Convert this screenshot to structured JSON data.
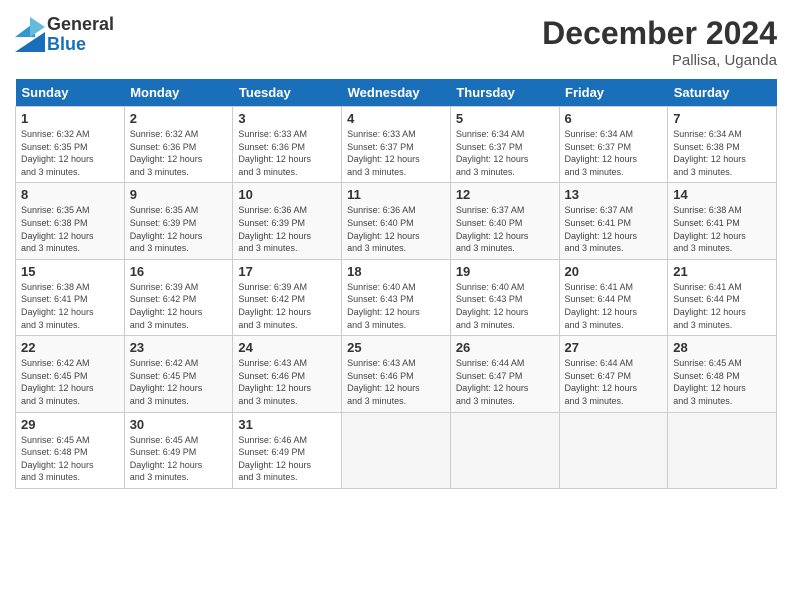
{
  "logo": {
    "general": "General",
    "blue": "Blue"
  },
  "title": "December 2024",
  "location": "Pallisa, Uganda",
  "days_header": [
    "Sunday",
    "Monday",
    "Tuesday",
    "Wednesday",
    "Thursday",
    "Friday",
    "Saturday"
  ],
  "weeks": [
    [
      {
        "num": "1",
        "rise": "6:32 AM",
        "set": "6:35 PM",
        "daylight": "12 hours and 3 minutes."
      },
      {
        "num": "2",
        "rise": "6:32 AM",
        "set": "6:36 PM",
        "daylight": "12 hours and 3 minutes."
      },
      {
        "num": "3",
        "rise": "6:33 AM",
        "set": "6:36 PM",
        "daylight": "12 hours and 3 minutes."
      },
      {
        "num": "4",
        "rise": "6:33 AM",
        "set": "6:37 PM",
        "daylight": "12 hours and 3 minutes."
      },
      {
        "num": "5",
        "rise": "6:34 AM",
        "set": "6:37 PM",
        "daylight": "12 hours and 3 minutes."
      },
      {
        "num": "6",
        "rise": "6:34 AM",
        "set": "6:37 PM",
        "daylight": "12 hours and 3 minutes."
      },
      {
        "num": "7",
        "rise": "6:34 AM",
        "set": "6:38 PM",
        "daylight": "12 hours and 3 minutes."
      }
    ],
    [
      {
        "num": "8",
        "rise": "6:35 AM",
        "set": "6:38 PM",
        "daylight": "12 hours and 3 minutes."
      },
      {
        "num": "9",
        "rise": "6:35 AM",
        "set": "6:39 PM",
        "daylight": "12 hours and 3 minutes."
      },
      {
        "num": "10",
        "rise": "6:36 AM",
        "set": "6:39 PM",
        "daylight": "12 hours and 3 minutes."
      },
      {
        "num": "11",
        "rise": "6:36 AM",
        "set": "6:40 PM",
        "daylight": "12 hours and 3 minutes."
      },
      {
        "num": "12",
        "rise": "6:37 AM",
        "set": "6:40 PM",
        "daylight": "12 hours and 3 minutes."
      },
      {
        "num": "13",
        "rise": "6:37 AM",
        "set": "6:41 PM",
        "daylight": "12 hours and 3 minutes."
      },
      {
        "num": "14",
        "rise": "6:38 AM",
        "set": "6:41 PM",
        "daylight": "12 hours and 3 minutes."
      }
    ],
    [
      {
        "num": "15",
        "rise": "6:38 AM",
        "set": "6:41 PM",
        "daylight": "12 hours and 3 minutes."
      },
      {
        "num": "16",
        "rise": "6:39 AM",
        "set": "6:42 PM",
        "daylight": "12 hours and 3 minutes."
      },
      {
        "num": "17",
        "rise": "6:39 AM",
        "set": "6:42 PM",
        "daylight": "12 hours and 3 minutes."
      },
      {
        "num": "18",
        "rise": "6:40 AM",
        "set": "6:43 PM",
        "daylight": "12 hours and 3 minutes."
      },
      {
        "num": "19",
        "rise": "6:40 AM",
        "set": "6:43 PM",
        "daylight": "12 hours and 3 minutes."
      },
      {
        "num": "20",
        "rise": "6:41 AM",
        "set": "6:44 PM",
        "daylight": "12 hours and 3 minutes."
      },
      {
        "num": "21",
        "rise": "6:41 AM",
        "set": "6:44 PM",
        "daylight": "12 hours and 3 minutes."
      }
    ],
    [
      {
        "num": "22",
        "rise": "6:42 AM",
        "set": "6:45 PM",
        "daylight": "12 hours and 3 minutes."
      },
      {
        "num": "23",
        "rise": "6:42 AM",
        "set": "6:45 PM",
        "daylight": "12 hours and 3 minutes."
      },
      {
        "num": "24",
        "rise": "6:43 AM",
        "set": "6:46 PM",
        "daylight": "12 hours and 3 minutes."
      },
      {
        "num": "25",
        "rise": "6:43 AM",
        "set": "6:46 PM",
        "daylight": "12 hours and 3 minutes."
      },
      {
        "num": "26",
        "rise": "6:44 AM",
        "set": "6:47 PM",
        "daylight": "12 hours and 3 minutes."
      },
      {
        "num": "27",
        "rise": "6:44 AM",
        "set": "6:47 PM",
        "daylight": "12 hours and 3 minutes."
      },
      {
        "num": "28",
        "rise": "6:45 AM",
        "set": "6:48 PM",
        "daylight": "12 hours and 3 minutes."
      }
    ],
    [
      {
        "num": "29",
        "rise": "6:45 AM",
        "set": "6:48 PM",
        "daylight": "12 hours and 3 minutes."
      },
      {
        "num": "30",
        "rise": "6:45 AM",
        "set": "6:49 PM",
        "daylight": "12 hours and 3 minutes."
      },
      {
        "num": "31",
        "rise": "6:46 AM",
        "set": "6:49 PM",
        "daylight": "12 hours and 3 minutes."
      },
      null,
      null,
      null,
      null
    ]
  ],
  "labels": {
    "sunrise": "Sunrise:",
    "sunset": "Sunset:",
    "daylight": "Daylight:"
  }
}
